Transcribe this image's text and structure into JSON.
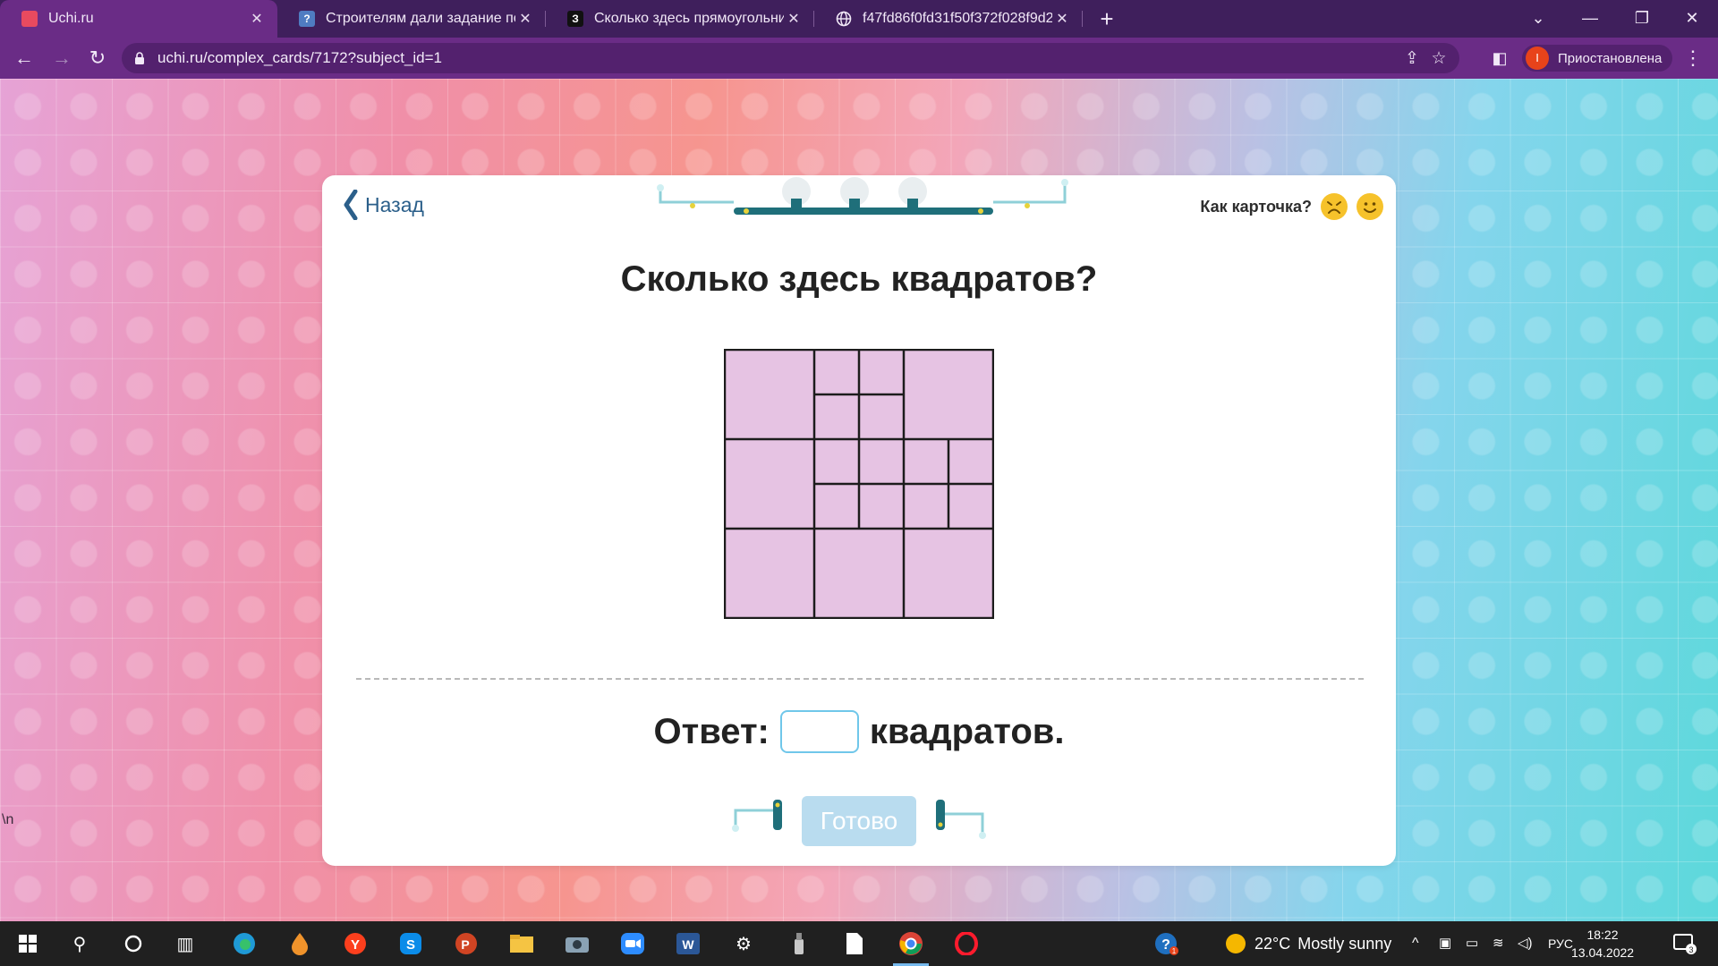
{
  "browser": {
    "tabs": [
      {
        "title": "Uchi.ru",
        "favicon": "uchi-favicon-icon",
        "active": true
      },
      {
        "title": "Строителям дали задание постр",
        "favicon": "question-favicon-icon",
        "active": false
      },
      {
        "title": "Сколько здесь прямоугольнико",
        "favicon": "znanija-favicon-icon",
        "favicon_text": "З",
        "active": false
      },
      {
        "title": "f47fd86f0fd31f50f372f028f9d255",
        "favicon": "globe-favicon-icon",
        "active": false
      }
    ],
    "url": "uchi.ru/complex_cards/7172?subject_id=1",
    "profile_label": "Приостановлена",
    "profile_initial": "I"
  },
  "card": {
    "back_label": "Назад",
    "rate_label": "Как карточка?",
    "question": "Сколько здесь квадратов?",
    "answer_prefix": "Ответ:",
    "answer_value": "",
    "answer_suffix": "квадратов.",
    "done_label": "Готово"
  },
  "page": {
    "stray_text": "\\n"
  },
  "taskbar": {
    "weather_temp": "22°C",
    "weather_text": "Mostly sunny",
    "language": "РУС",
    "time": "18:22",
    "date": "13.04.2022",
    "notification_count": "3",
    "help_badge": "1"
  },
  "colors": {
    "accent": "#6a2c86",
    "figure_fill": "#e6c3e3",
    "done_button": "#b9dcef",
    "input_border": "#70c7ea"
  }
}
